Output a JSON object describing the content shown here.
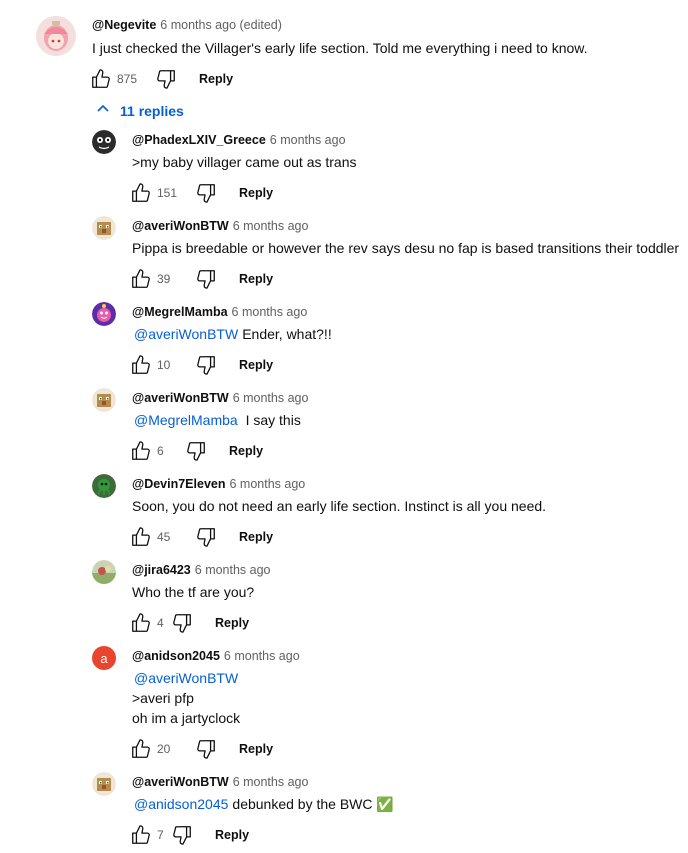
{
  "top_comment": {
    "handle": "@Negevite",
    "time": "6 months ago (edited)",
    "text": "I just checked the Villager's early life section. Told me everything i need to know.",
    "likes": "875",
    "reply_label": "Reply"
  },
  "replies_toggle": {
    "label": "11 replies",
    "icon": "chevron-up-icon"
  },
  "replies": [
    {
      "handle": "@PhadexLXIV_Greece",
      "time": "6 months ago",
      "mention": "",
      "lines": [
        ">my baby villager came out as trans"
      ],
      "likes": "151",
      "reply_label": "Reply"
    },
    {
      "handle": "@averiWonBTW",
      "time": "6 months ago",
      "mention": "",
      "lines": [
        "Pippa is breedable or however the rev says desu no fap is based transitions their toddler"
      ],
      "likes": "39",
      "reply_label": "Reply"
    },
    {
      "handle": "@MegrelMamba",
      "time": "6 months ago",
      "mention": "@averiWonBTW",
      "lines": [
        "Ender, what?!!"
      ],
      "likes": "10",
      "reply_label": "Reply"
    },
    {
      "handle": "@averiWonBTW",
      "time": "6 months ago",
      "mention": "@MegrelMamba",
      "lines": [
        " I say this"
      ],
      "likes": "6",
      "reply_label": "Reply"
    },
    {
      "handle": "@Devin7Eleven",
      "time": "6 months ago",
      "mention": "",
      "lines": [
        "Soon, you do not need an early life section. Instinct is all you need."
      ],
      "likes": "45",
      "reply_label": "Reply"
    },
    {
      "handle": "@jira6423",
      "time": "6 months ago",
      "mention": "",
      "lines": [
        "Who the tf are you?"
      ],
      "likes": "4",
      "reply_label": "Reply"
    },
    {
      "handle": "@anidson2045",
      "time": "6 months ago",
      "mention": "@averiWonBTW",
      "lines": [
        ">averi pfp",
        "oh im a jartyclock"
      ],
      "avatar_letter": "a",
      "likes": "20",
      "reply_label": "Reply"
    },
    {
      "handle": "@averiWonBTW",
      "time": "6 months ago",
      "mention": "@anidson2045",
      "lines": [
        "debunked by the BWC ✅"
      ],
      "likes": "7",
      "reply_label": "Reply"
    }
  ],
  "icons": {
    "like": "thumbs-up-icon",
    "dislike": "thumbs-down-icon"
  },
  "colors": {
    "link": "#065fd4",
    "meta": "#606060",
    "avatar_a": "#e8452c"
  }
}
